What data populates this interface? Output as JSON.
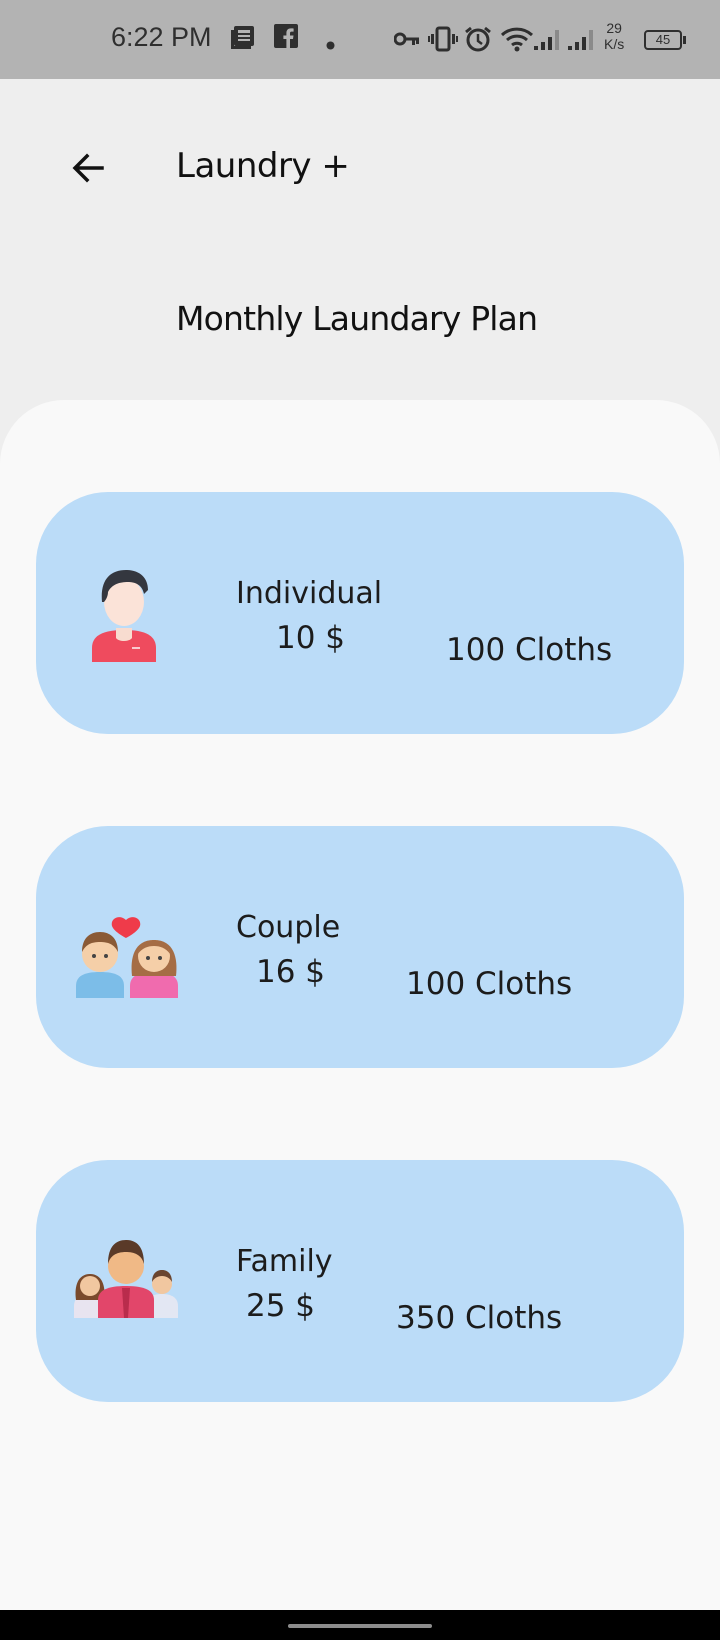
{
  "status_bar": {
    "time": "6:22 PM",
    "speed_value": "29",
    "speed_unit": "K/s",
    "battery": "45",
    "icons": [
      "news-icon",
      "facebook-icon",
      "dot-icon",
      "vpn-key-icon",
      "vibrate-icon",
      "alarm-icon",
      "wifi-icon",
      "signal-icon",
      "signal-icon"
    ]
  },
  "app_bar": {
    "back_icon": "arrow-left-icon",
    "title": "Laundry +"
  },
  "page": {
    "heading": "Monthly Laundary Plan"
  },
  "plans": [
    {
      "name": "Individual",
      "price": "10 $",
      "cloths": "100 Cloths",
      "icon": "person-icon"
    },
    {
      "name": "Couple",
      "price": "16 $",
      "cloths": "100 Cloths",
      "icon": "couple-icon"
    },
    {
      "name": "Family",
      "price": "25 $",
      "cloths": "350 Cloths",
      "icon": "family-icon"
    }
  ],
  "colors": {
    "card": "#bbdcf8",
    "background": "#eeeeee",
    "sheet": "#f9f9f9",
    "status_bar": "#b3b3b3"
  }
}
